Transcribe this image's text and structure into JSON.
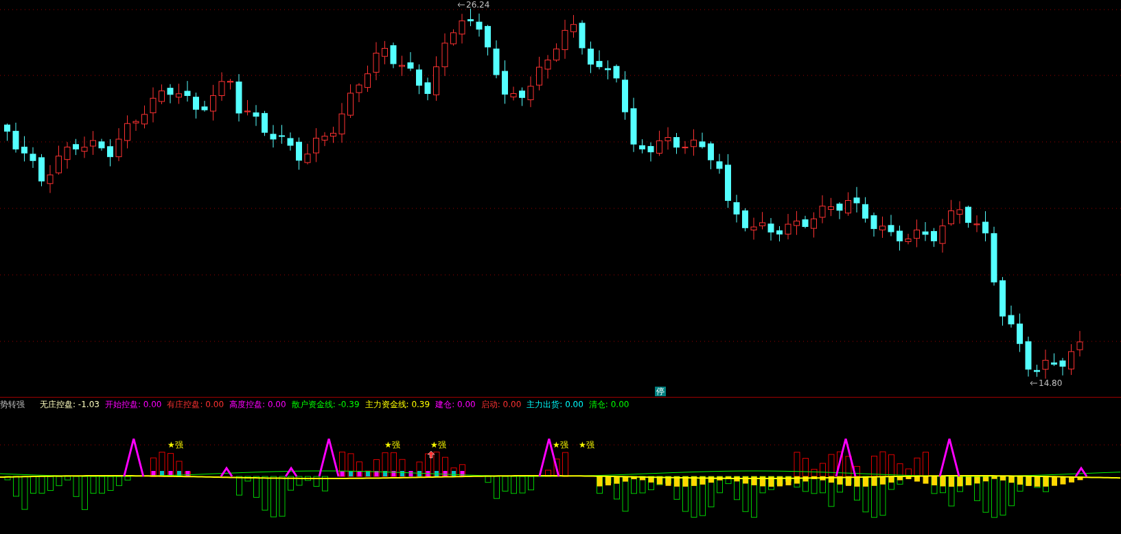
{
  "price_chart": {
    "high_label": "26.24",
    "low_label": "14.80",
    "badge": "停"
  },
  "indicator": {
    "title": "势转强",
    "legend": [
      {
        "label": "无庄控盘:",
        "value": "-1.03",
        "color": "#ffffc0"
      },
      {
        "label": "开始控盘:",
        "value": "0.00",
        "color": "#ff00ff"
      },
      {
        "label": "有庄控盘:",
        "value": "0.00",
        "color": "#ff3232"
      },
      {
        "label": "高度控盘:",
        "value": "0.00",
        "color": "#ff00ff"
      },
      {
        "label": "散户资金线:",
        "value": "-0.39",
        "color": "#00ff00"
      },
      {
        "label": "主力资金线:",
        "value": "0.39",
        "color": "#ffff00"
      },
      {
        "label": "建仓:",
        "value": "0.00",
        "color": "#ff00ff"
      },
      {
        "label": "启动:",
        "value": "0.00",
        "color": "#ff3232"
      },
      {
        "label": "主力出货:",
        "value": "0.00",
        "color": "#00ffff"
      },
      {
        "label": "清仓:",
        "value": "0.00",
        "color": "#00ff00"
      }
    ],
    "signals": [
      {
        "text": "★强"
      },
      {
        "text": "★强"
      },
      {
        "text": "★强"
      },
      {
        "text": "★强"
      },
      {
        "text": "★强"
      }
    ]
  }
}
